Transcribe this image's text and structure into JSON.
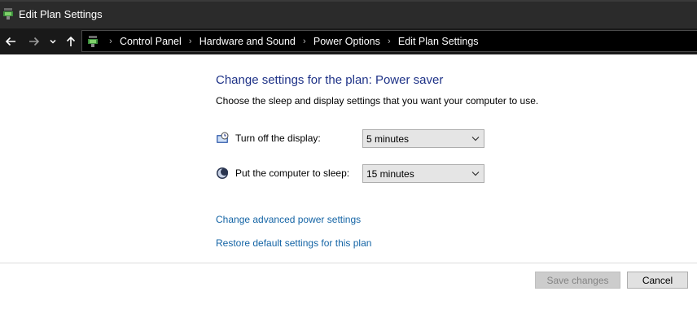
{
  "window": {
    "title": "Edit Plan Settings",
    "icon": "power-options-icon"
  },
  "navigation": {
    "back_icon": "arrow-left-icon",
    "forward_icon": "arrow-right-icon",
    "recent_icon": "chevron-down-icon",
    "up_icon": "arrow-up-icon",
    "address_icon": "power-options-icon",
    "breadcrumbs": [
      "Control Panel",
      "Hardware and Sound",
      "Power Options",
      "Edit Plan Settings"
    ]
  },
  "main": {
    "heading": "Change settings for the plan: Power saver",
    "description": "Choose the sleep and display settings that you want your computer to use.",
    "settings": [
      {
        "label": "Turn off the display:",
        "value": "5 minutes",
        "icon": "display-timer-icon"
      },
      {
        "label": "Put the computer to sleep:",
        "value": "15 minutes",
        "icon": "sleep-moon-icon"
      }
    ],
    "links": {
      "advanced": "Change advanced power settings",
      "restore": "Restore default settings for this plan"
    }
  },
  "footer": {
    "save_label": "Save changes",
    "save_enabled": false,
    "cancel_label": "Cancel"
  },
  "colors": {
    "heading": "#1e3287",
    "link": "#1464a5",
    "titlebar": "#2b2b2b",
    "navbar": "#191919"
  }
}
